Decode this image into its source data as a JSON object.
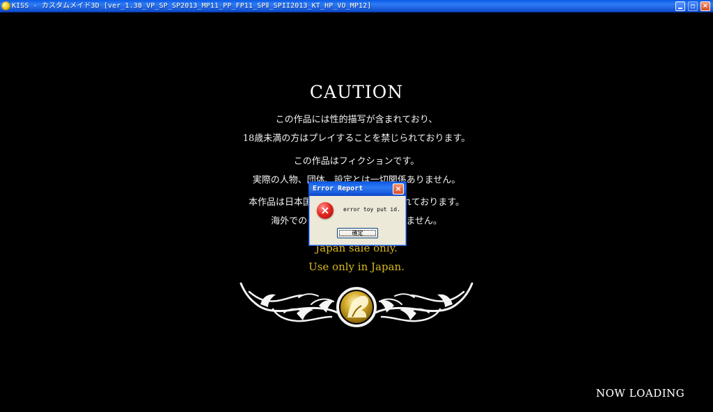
{
  "window": {
    "title": "KISS - カスタムメイド3D [ver_1.38_VP_SP_SP2013_MP11_PP_FP11_SPⅡ_SPII2013_KT_HP_VO_MP12]",
    "icons": {
      "app": "app-icon",
      "minimize": "minimize-icon",
      "maximize": "maximize-icon",
      "close": "close-icon"
    }
  },
  "caution": {
    "heading": "CAUTION",
    "lines": [
      "この作品には性的描写が含まれており、",
      "18歳未満の方はプレイすることを禁じられております。",
      "この作品はフィクションです。",
      "実際の人物、団体、設定とは一切関係ありません。",
      "本作品は日本国内でのみ販売が許諾されております。",
      "海外でのご利用は許可されておりません。"
    ],
    "japan_lines": [
      "Japan sale only.",
      "Use only in Japan."
    ]
  },
  "dialog": {
    "title": "Error Report",
    "message": "error toy put id.",
    "ok_label": "確定",
    "icon": "error-icon",
    "close_icon": "close-icon"
  },
  "status": {
    "loading": "NOW LOADING"
  },
  "colors": {
    "background": "#000000",
    "text_primary": "#f3f3f3",
    "accent_gold": "#d9b81d",
    "titlebar_blue": "#1f62e0",
    "dialog_surface": "#ece9d8",
    "error_red": "#e3261f"
  }
}
